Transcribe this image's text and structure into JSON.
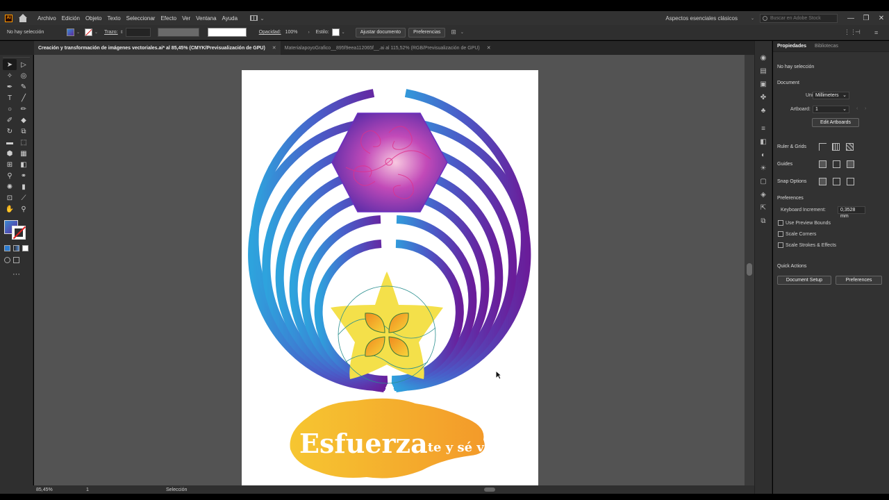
{
  "app": {
    "logo": "Ai",
    "menu": [
      "Archivo",
      "Edición",
      "Objeto",
      "Texto",
      "Seleccionar",
      "Efecto",
      "Ver",
      "Ventana",
      "Ayuda"
    ],
    "workspace": "Aspectos esenciales clásicos",
    "stock_search_placeholder": "Buscar en Adobe Stock",
    "window_buttons": [
      "—",
      "❐",
      "✕"
    ]
  },
  "controlbar": {
    "selection_label": "No hay selección",
    "stroke_label": "Trazo:",
    "opacity_label": "Opacidad:",
    "opacity_value": "100%",
    "style_label": "Estilo:",
    "fit_document_button": "Ajustar documento",
    "preferences_button": "Preferencias"
  },
  "tabs": [
    {
      "label": "Creación y transformación de imágenes vectoriales.ai* al 85,45% (CMYK/Previsualización de GPU)",
      "active": true
    },
    {
      "label": "MaterialapoyoGrafico__895f9eea112065f__.ai al 115,52% (RGB/Previsualización de GPU)",
      "active": false
    }
  ],
  "artboard": {
    "headline_big": "Esfuerza",
    "headline_small": "te y sé valiente"
  },
  "status": {
    "zoom": "85,45%",
    "artboard_index": "1",
    "tool": "Selección"
  },
  "properties": {
    "tabs": [
      "Propiedades",
      "Bibliotecas"
    ],
    "selection_state": "No hay selección",
    "document_heading": "Document",
    "units_label": "Units:",
    "units_value": "Millimeters",
    "artboard_label": "Artboard:",
    "artboard_value": "1",
    "edit_artboards_button": "Edit Artboards",
    "rulers_heading": "Ruler & Grids",
    "guides_heading": "Guides",
    "snap_heading": "Snap Options",
    "preferences_heading": "Preferences",
    "keyboard_increment_label": "Keyboard Increment:",
    "keyboard_increment_value": "0,3528 mm",
    "use_preview_bounds": "Use Preview Bounds",
    "scale_corners": "Scale Corners",
    "scale_strokes": "Scale Strokes & Effects",
    "quick_actions_heading": "Quick Actions",
    "document_setup_button": "Document Setup",
    "preferences_button": "Preferences"
  },
  "colors": {
    "blue": "#2ea3dd",
    "purple": "#6a1d9a",
    "yellow": "#f4e04a",
    "orange": "#f39a2a",
    "magenta": "#e02a9a"
  }
}
